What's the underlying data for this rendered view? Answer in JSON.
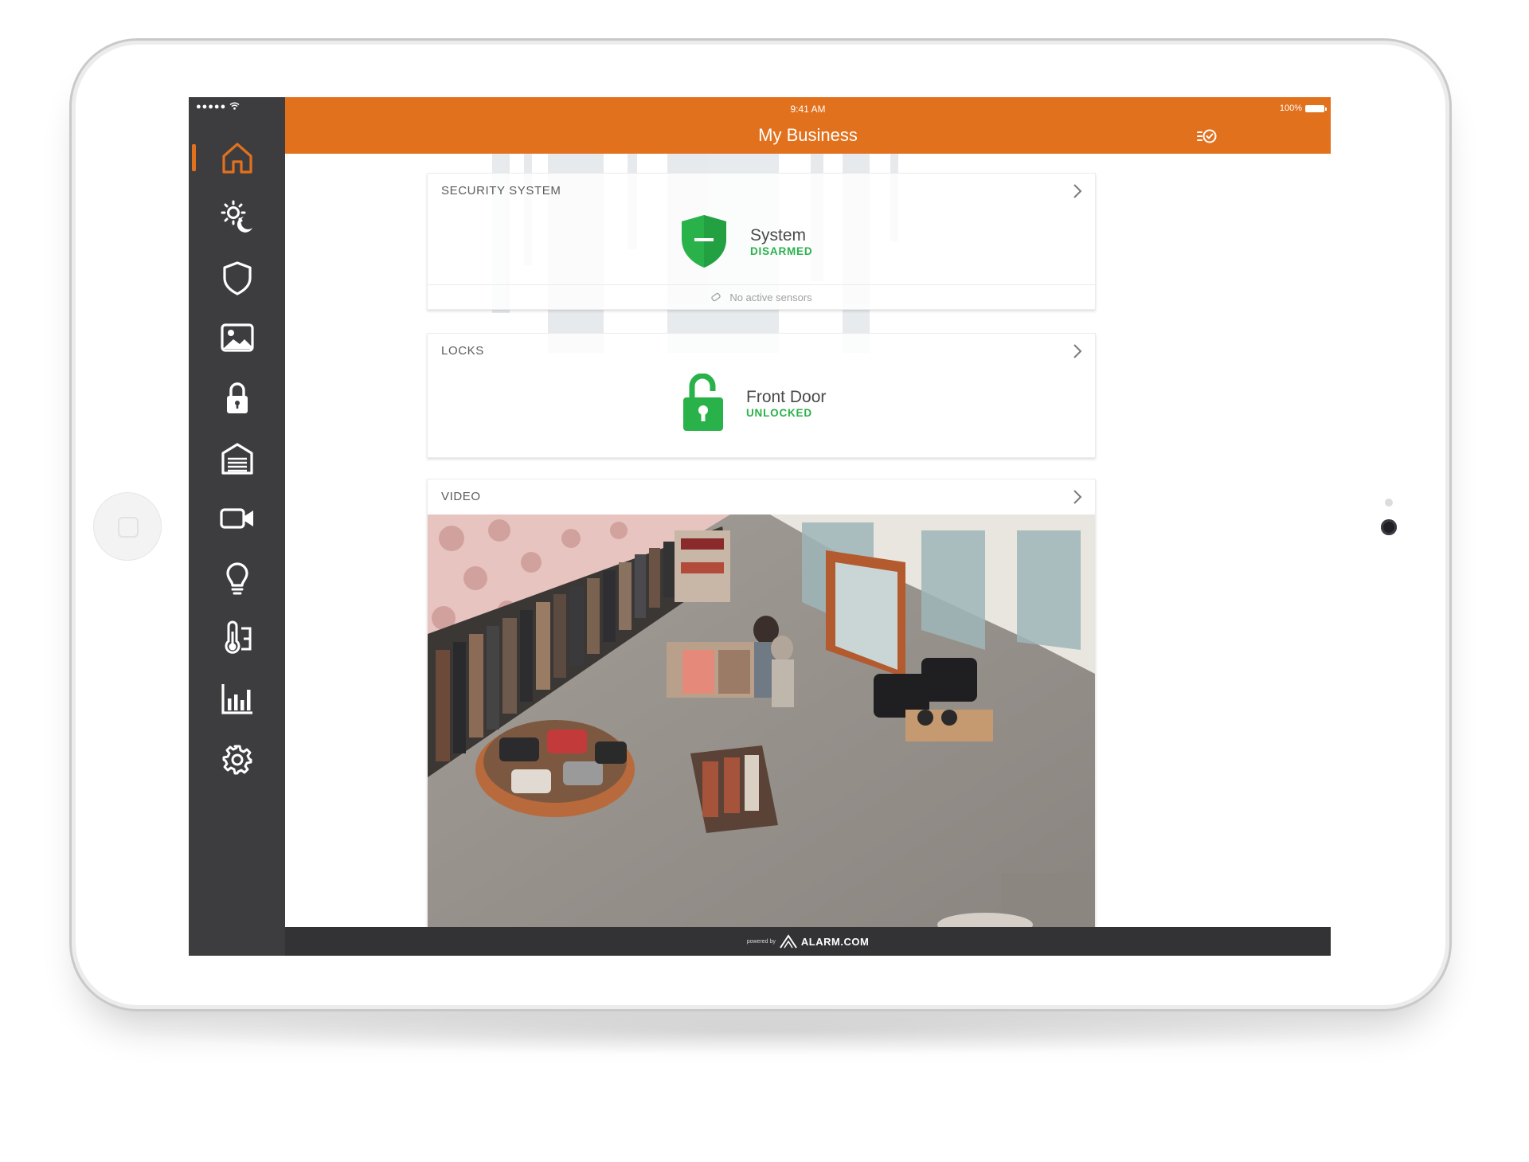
{
  "status_bar": {
    "signal": "●●●●● ",
    "time": "9:41 AM",
    "battery": "100%"
  },
  "header": {
    "title": "My Business"
  },
  "sidebar": {
    "items": [
      {
        "icon": "home-icon",
        "active": true
      },
      {
        "icon": "day-night-icon",
        "active": false
      },
      {
        "icon": "shield-icon",
        "active": false
      },
      {
        "icon": "image-icon",
        "active": false
      },
      {
        "icon": "lock-icon",
        "active": false
      },
      {
        "icon": "garage-icon",
        "active": false
      },
      {
        "icon": "video-camera-icon",
        "active": false
      },
      {
        "icon": "lightbulb-icon",
        "active": false
      },
      {
        "icon": "thermostat-icon",
        "active": false
      },
      {
        "icon": "bar-chart-icon",
        "active": false
      },
      {
        "icon": "gear-icon",
        "active": false
      }
    ]
  },
  "cards": {
    "security": {
      "title": "SECURITY SYSTEM",
      "name": "System",
      "status": "DISARMED",
      "footer": "No active sensors"
    },
    "locks": {
      "title": "LOCKS",
      "name": "Front Door",
      "status": "UNLOCKED"
    },
    "video": {
      "title": "VIDEO"
    }
  },
  "footer": {
    "powered_by": "powered by",
    "brand": "ALARM.COM"
  },
  "colors": {
    "accent": "#e2711d",
    "sidebar": "#3d3d3f",
    "ok_green": "#29b24a"
  }
}
